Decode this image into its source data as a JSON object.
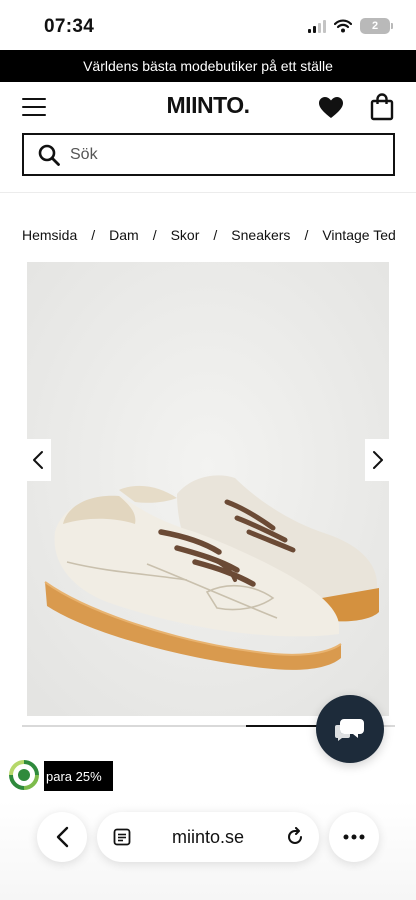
{
  "status_bar": {
    "time": "07:34",
    "battery": "2",
    "icons": [
      "signal-icon",
      "wifi-icon",
      "battery-icon"
    ]
  },
  "promo": {
    "text": "Världens bästa modebutiker på ett ställe"
  },
  "header": {
    "logo": "MIINTO.",
    "icons": [
      "menu-icon",
      "heart-icon",
      "shopping-bag-icon"
    ]
  },
  "search": {
    "placeholder": "Sök",
    "value": ""
  },
  "breadcrumb": {
    "items": [
      "Hemsida",
      "Dam",
      "Skor",
      "Sneakers",
      "Vintage Ted"
    ],
    "separator": "/"
  },
  "gallery": {
    "image": "off-white shearling-lined leather sneakers with brown laces and gum sole",
    "prev_icon": "chevron-left-icon",
    "next_icon": "chevron-right-icon",
    "progress_start": 0.6,
    "progress_end": 0.8
  },
  "chat": {
    "icon": "chat-bubbles-icon"
  },
  "badge": {
    "text": "para 25%",
    "icon": "eco-icon"
  },
  "browser": {
    "url": "miinto.se",
    "icons": [
      "back-icon",
      "reader-icon",
      "reload-icon",
      "more-icon"
    ]
  },
  "colors": {
    "accent_dark": "#000000",
    "chat_bg": "#1d2b3a",
    "image_bg": "#ededeb",
    "sole": "#d99a4e",
    "laces": "#6b4a35"
  }
}
